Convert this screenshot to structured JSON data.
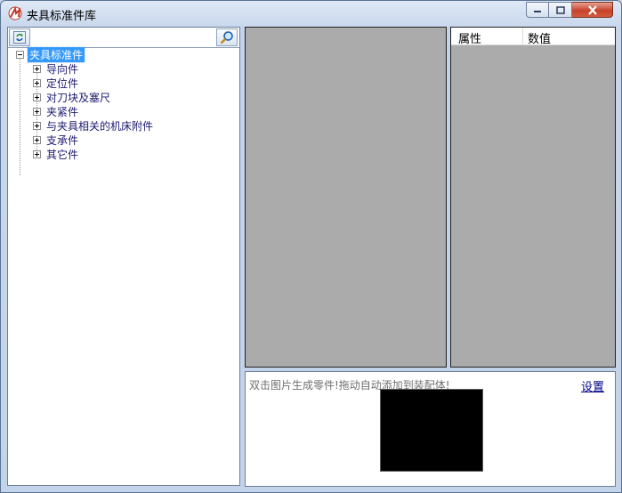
{
  "window": {
    "title": "夹具标准件库",
    "colors": {
      "accent": "#3399ff",
      "close": "#c7432b",
      "frame": "#c3d3ea",
      "panel_gray": "#ababab"
    }
  },
  "toolbar": {
    "refresh_icon": "refresh-icon",
    "search_icon": "search-icon",
    "search_value": ""
  },
  "tree": {
    "root": "夹具标准件",
    "children": [
      "导向件",
      "定位件",
      "对刀块及塞尺",
      "夹紧件",
      "与夹具相关的机床附件",
      "支承件",
      "其它件"
    ]
  },
  "properties": {
    "col_attr": "属性",
    "col_value": "数值"
  },
  "bottom": {
    "hint": "双击图片生成零件!拖动自动添加到装配体!",
    "settings": "设置"
  }
}
